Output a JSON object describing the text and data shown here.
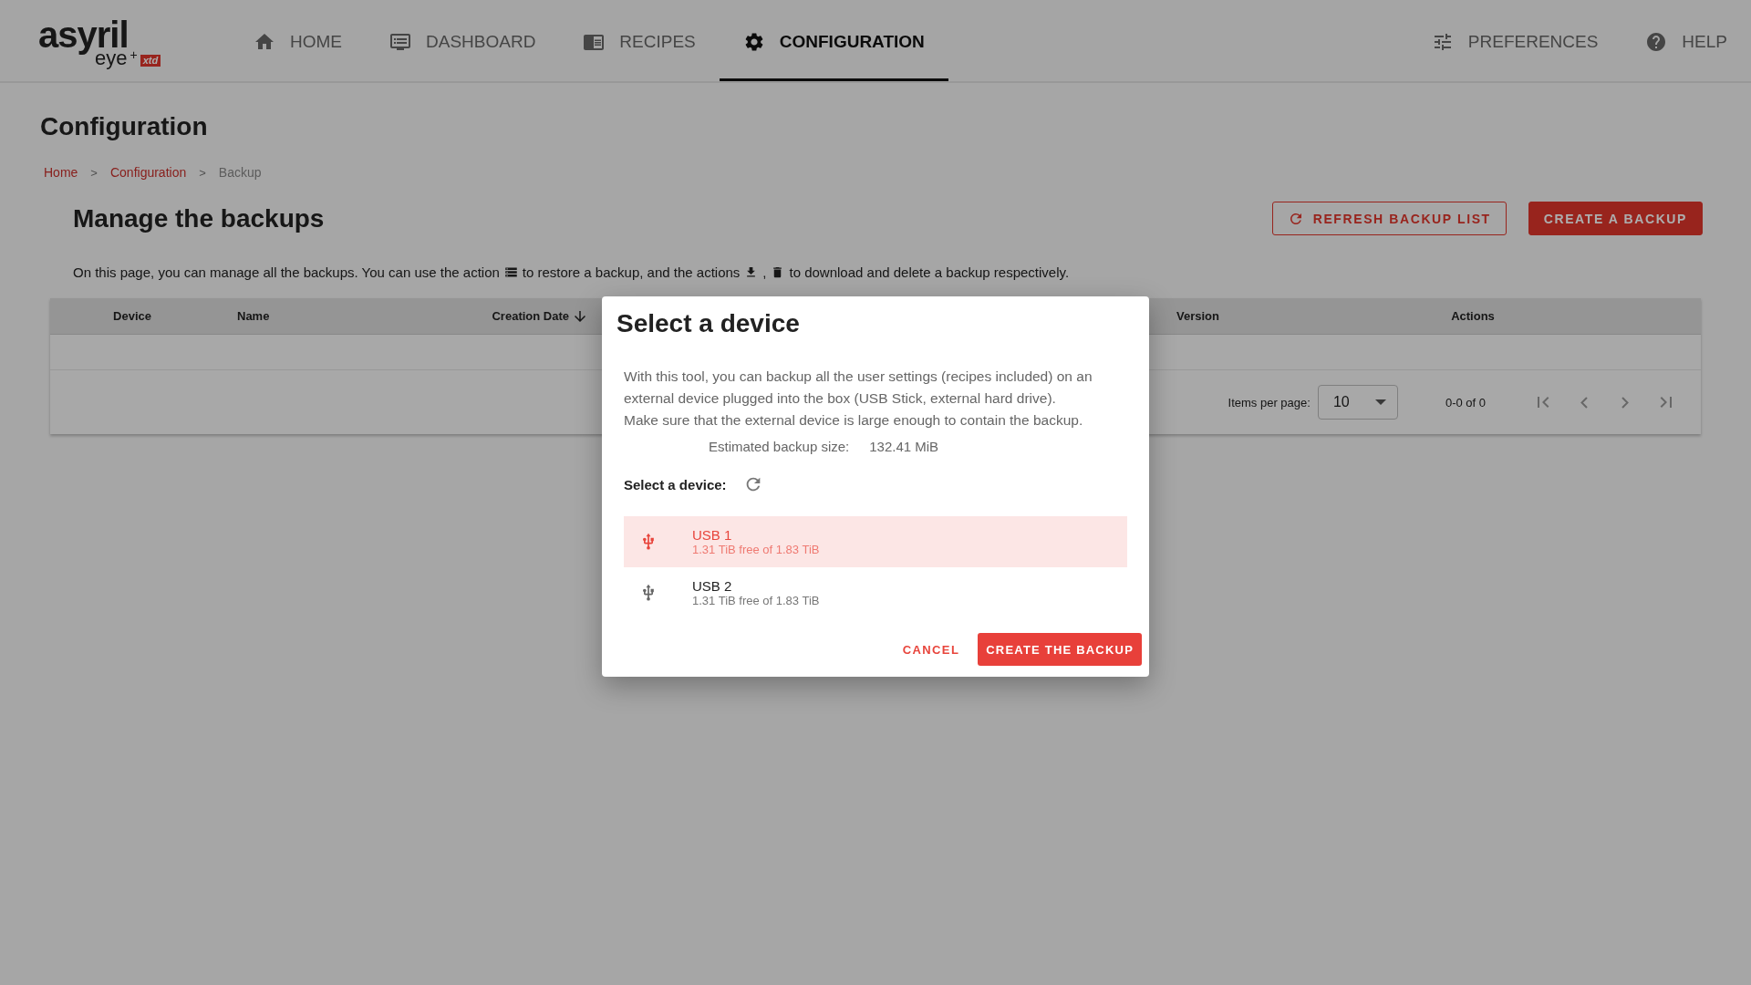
{
  "logo": {
    "name": "asyril",
    "sub": "eye",
    "sup": "+",
    "badge": "xtd"
  },
  "nav": [
    {
      "label": "HOME",
      "selected": false
    },
    {
      "label": "DASHBOARD",
      "selected": false
    },
    {
      "label": "RECIPES",
      "selected": false
    },
    {
      "label": "CONFIGURATION",
      "selected": true
    }
  ],
  "nav_right": [
    {
      "label": "PREFERENCES",
      "selected": false
    },
    {
      "label": "HELP",
      "selected": false
    }
  ],
  "page_title": "Configuration",
  "breadcrumb": [
    "Home",
    "Configuration",
    "Backup"
  ],
  "breadcrumb_separator": ">",
  "section_title": "Manage the backups",
  "buttons": [
    {
      "label": "REFRESH BACKUP LIST",
      "kind": "outlined"
    },
    {
      "label": "CREATE A BACKUP",
      "kind": "filled"
    }
  ],
  "description": [
    "On this page, you can manage all the backups. You can use the action",
    "to restore a backup, and the actions",
    ",",
    "to download and delete a backup respectively."
  ],
  "table": {
    "columns": [
      {
        "label": "Device",
        "sorted": false
      },
      {
        "label": "Name",
        "sorted": false
      },
      {
        "label": "Creation Date",
        "sorted": true
      },
      {
        "label": "Version",
        "sorted": false
      },
      {
        "label": "Actions",
        "sorted": false
      }
    ],
    "paginator": {
      "items_label": "Items per page:",
      "page_size": "10",
      "range": "0-0 of 0"
    }
  },
  "dialog": {
    "title": "Select a device",
    "text": [
      "With this tool, you can backup all the user settings (recipes included) on an external device plugged into the box (USB Stick, external hard drive).",
      "Make sure that the external device is large enough to contain the backup."
    ],
    "size_label": "Estimated backup size:",
    "size_value": "132.41 MiB",
    "select_label": "Select a device:",
    "devices": [
      {
        "name": "USB 1",
        "detail": "1.31 TiB free of 1.83 TiB",
        "selected": true
      },
      {
        "name": "USB 2",
        "detail": "1.31 TiB free of 1.83 TiB",
        "selected": false
      }
    ],
    "cancel": "CANCEL",
    "confirm": "CREATE THE BACKUP"
  }
}
